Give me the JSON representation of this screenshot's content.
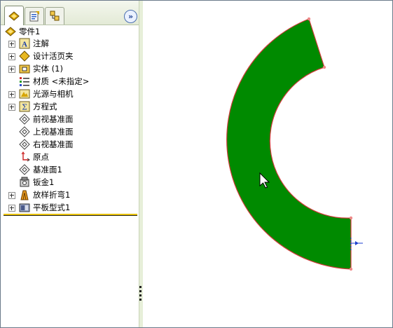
{
  "tabs": [
    {
      "name": "feature-manager-icon",
      "active": true
    },
    {
      "name": "property-manager-icon",
      "active": false
    },
    {
      "name": "configuration-manager-icon",
      "active": false
    }
  ],
  "collapse_label": "»",
  "tree": {
    "root": "零件1",
    "items": [
      {
        "label": "注解",
        "icon": "annotation-icon",
        "expandable": true
      },
      {
        "label": "设计活页夹",
        "icon": "design-binder-icon",
        "expandable": true
      },
      {
        "label": "实体 (1)",
        "icon": "solid-bodies-icon",
        "expandable": true
      },
      {
        "label": "材质 <未指定>",
        "icon": "material-icon",
        "expandable": false
      },
      {
        "label": "光源与相机",
        "icon": "lights-cameras-icon",
        "expandable": true
      },
      {
        "label": "方程式",
        "icon": "equations-icon",
        "expandable": true
      },
      {
        "label": "前视基准面",
        "icon": "plane-icon",
        "expandable": false
      },
      {
        "label": "上视基准面",
        "icon": "plane-icon",
        "expandable": false
      },
      {
        "label": "右视基准面",
        "icon": "plane-icon",
        "expandable": false
      },
      {
        "label": "原点",
        "icon": "origin-icon",
        "expandable": false
      },
      {
        "label": "基准面1",
        "icon": "plane-icon",
        "expandable": false
      },
      {
        "label": "钣金1",
        "icon": "sheet-metal-icon",
        "expandable": false
      },
      {
        "label": "放样折弯1",
        "icon": "lofted-bend-icon",
        "expandable": true
      },
      {
        "label": "平板型式1",
        "icon": "flat-pattern-icon",
        "expandable": true
      }
    ]
  },
  "colors": {
    "part_fill": "#008a00",
    "part_edge": "#d13b3b",
    "accent_bar": "#e8c200"
  }
}
